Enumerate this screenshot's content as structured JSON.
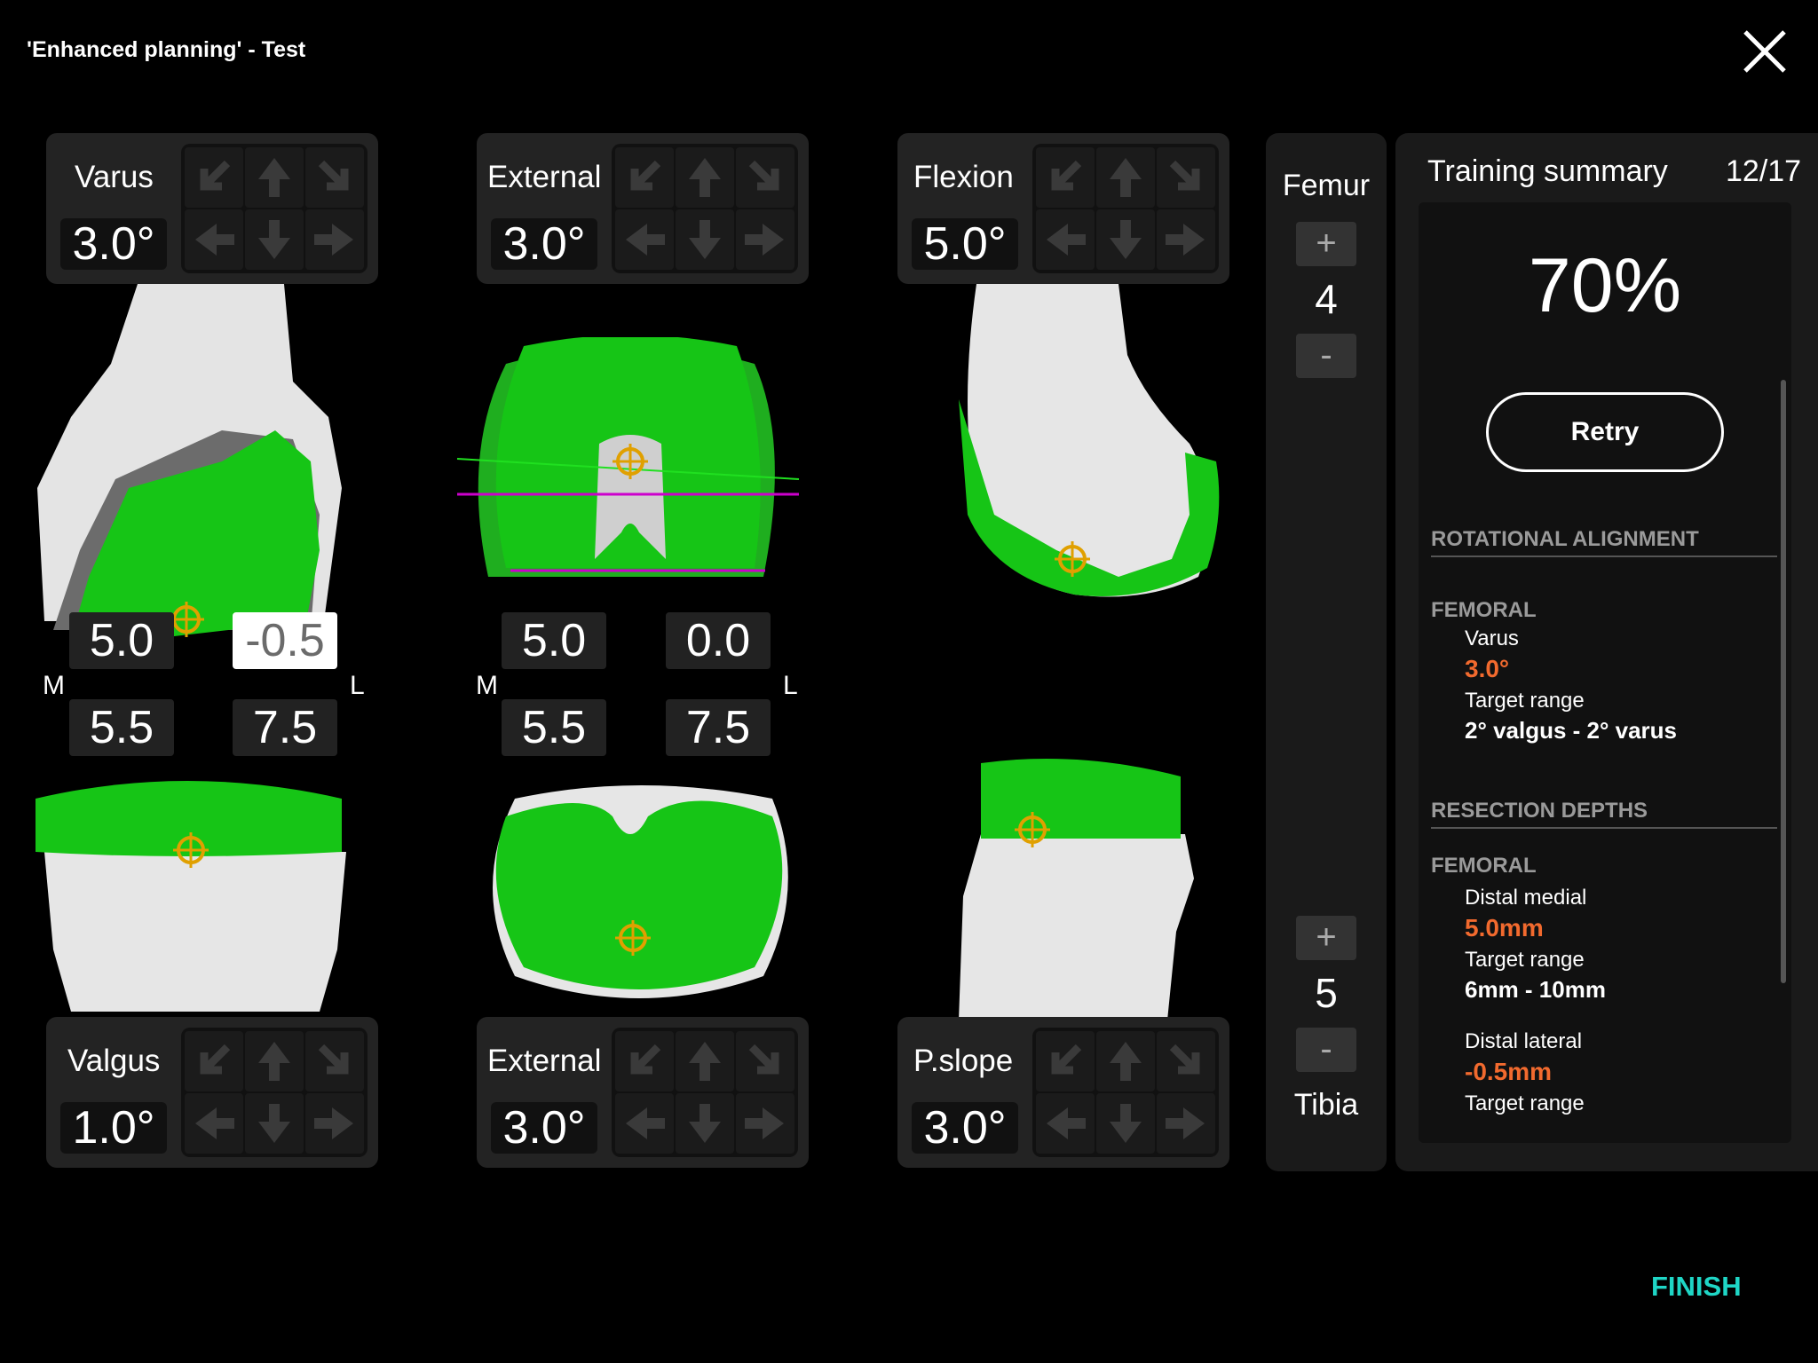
{
  "header": {
    "title": "'Enhanced planning' - Test"
  },
  "icons": {
    "close": "close-icon",
    "arrows": [
      "rotate-left-icon",
      "arrow-up-icon",
      "rotate-right-icon",
      "arrow-left-icon",
      "arrow-down-icon",
      "arrow-right-icon"
    ]
  },
  "colors": {
    "implant": "#16c516",
    "accent_orange": "#f26a2e",
    "finish": "#1fd6c6",
    "panel": "#232323"
  },
  "top_controls": [
    {
      "label": "Varus",
      "value": "3.0°"
    },
    {
      "label": "External",
      "value": "3.0°"
    },
    {
      "label": "Flexion",
      "value": "5.0°"
    }
  ],
  "bottom_controls": [
    {
      "label": "Valgus",
      "value": "1.0°"
    },
    {
      "label": "External",
      "value": "3.0°"
    },
    {
      "label": "P.slope",
      "value": "3.0°"
    }
  ],
  "measurements": {
    "view1": {
      "m_top": "5.0",
      "l_top": "-0.5",
      "m_bottom": "5.5",
      "l_bottom": "7.5",
      "m_label": "M",
      "l_label": "L"
    },
    "view2": {
      "m_top": "5.0",
      "l_top": "0.0",
      "m_bottom": "5.5",
      "l_bottom": "7.5",
      "m_label": "M",
      "l_label": "L"
    }
  },
  "component_selector": {
    "femur_label": "Femur",
    "femur_size": "4",
    "tibia_label": "Tibia",
    "tibia_size": "5",
    "plus": "+",
    "minus": "-"
  },
  "summary": {
    "title": "Training summary",
    "progress": "12/17",
    "score": "70%",
    "retry_label": "Retry",
    "section_rotational": "ROTATIONAL ALIGNMENT",
    "femoral_head_1": "FEMORAL",
    "varus_label": "Varus",
    "varus_value": "3.0°",
    "target_range_label": "Target range",
    "varus_target": "2° valgus - 2° varus",
    "section_resection": "RESECTION DEPTHS",
    "femoral_head_2": "FEMORAL",
    "distal_medial_label": "Distal medial",
    "distal_medial_value": "5.0mm",
    "distal_medial_target": "6mm - 10mm",
    "distal_lateral_label": "Distal lateral",
    "distal_lateral_value": "-0.5mm"
  },
  "footer": {
    "finish_label": "FINISH"
  }
}
